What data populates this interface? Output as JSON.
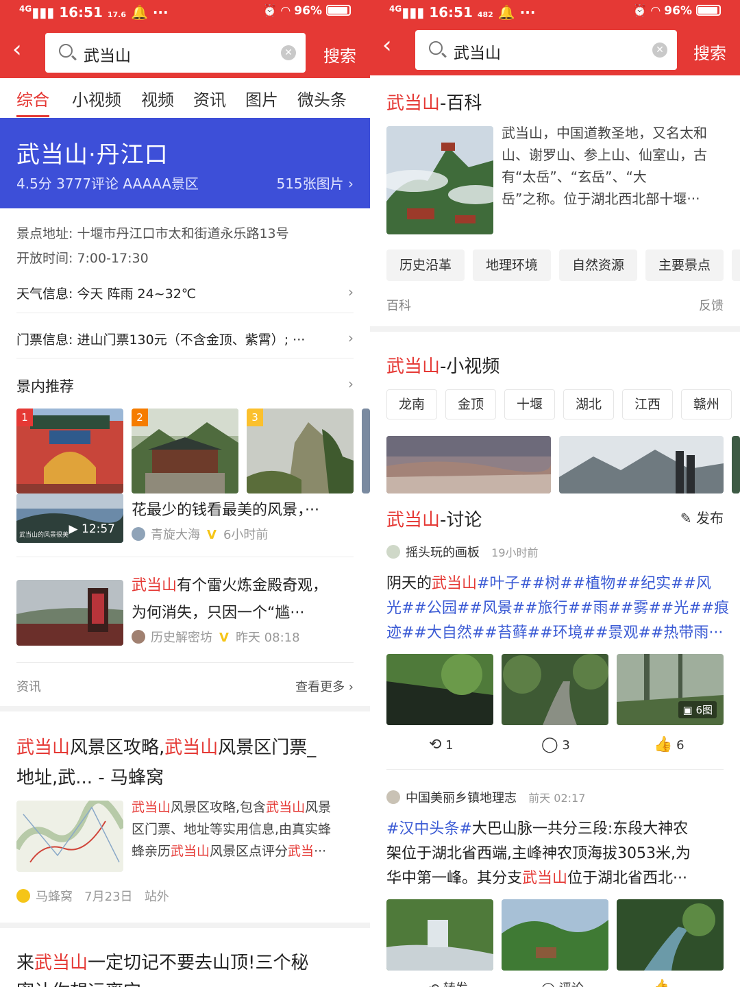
{
  "left": {
    "status": {
      "time": "16:51",
      "net": "17.6",
      "battery": "96%"
    },
    "search": {
      "query": "武当山",
      "button": "搜索"
    },
    "tabs": [
      "综合",
      "小视频",
      "视频",
      "资讯",
      "图片",
      "微头条"
    ],
    "hero": {
      "title": "武当山·丹江口",
      "meta": "4.5分  3777评论  AAAAA景区",
      "images": "515张图片 ›"
    },
    "info": {
      "address": "景点地址: 十堰市丹江口市太和街道永乐路13号",
      "hours": "开放时间: 7:00-17:30",
      "weather": "天气信息: 今天  阵雨  24~32℃",
      "ticket": "门票信息: 进山门票130元（不含金顶、紫霄）; ···"
    },
    "recommend": {
      "title": "景内推荐",
      "ranks": [
        "1",
        "2",
        "3"
      ]
    },
    "news": [
      {
        "title": "花最少的钱看最美的风景，···",
        "author": "青旋大海",
        "time": "6小时前",
        "duration": "12:57",
        "caption": "武当山的风景很美"
      },
      {
        "title_hl": "武当山",
        "title_rest": "有个雷火炼金殿奇观，",
        "title2": "为何消失，只因一个“尴···",
        "author": "历史解密坊",
        "time": "昨天 08:18"
      }
    ],
    "news_footer": {
      "label": "资讯",
      "more": "查看更多 ›"
    },
    "web1": {
      "title_a": "武当山",
      "title_b": "风景区攻略,",
      "title_c": "武当山",
      "title_d": "风景区门票_",
      "title2": "地址,武... - 马蜂窝",
      "desc1_hl": "武当山",
      "desc1_a": "风景区攻略,包含",
      "desc1_hl2": "武当山",
      "desc1_b": "风景",
      "desc2": "区门票、地址等实用信息,由真实蜂",
      "desc3_a": "蜂亲历",
      "desc3_hl": "武当山",
      "desc3_b": "风景区点评分",
      "desc3_hl2": "武当",
      "desc3_c": "···",
      "source": "马蜂窝",
      "date": "7月23日",
      "site": "站外"
    },
    "web2": {
      "title_a": "来",
      "title_hl": "武当山",
      "title_b": "一定切记不要去山顶!三个秘",
      "title2": "密让你想运离它"
    }
  },
  "right": {
    "status": {
      "time": "16:51",
      "net": "482",
      "battery": "96%"
    },
    "search": {
      "query": "武当山",
      "button": "搜索"
    },
    "baike": {
      "title_hl": "武当山",
      "title_rest": "-百科",
      "lines": [
        "武当山，中国道教圣地，又名太和",
        "山、谢罗山、参上山、仙室山，古",
        "有“太岳”、“玄岳”、“大",
        "岳”之称。位于湖北西北部十堰···"
      ],
      "chips": [
        "历史沿革",
        "地理环境",
        "自然资源",
        "主要景点"
      ],
      "footer_left": "百科",
      "footer_right": "反馈"
    },
    "videos": {
      "title_hl": "武当山",
      "title_rest": "-小视频",
      "chips": [
        "龙南",
        "金顶",
        "十堰",
        "湖北",
        "江西",
        "赣州"
      ]
    },
    "discuss": {
      "title_hl": "武当山",
      "title_rest": "-讨论",
      "post": "发布",
      "post1": {
        "author": "摇头玩的画板",
        "time": "19小时前",
        "line1_a": "阴天的",
        "line1_hl": "武当山",
        "line1_tags": "#叶子##树##植物##纪实##风",
        "line2": "光##公园##风景##旅行##雨##雾##光##痕",
        "line3": "迹##大自然##苔藓##环境##景观##热带雨···",
        "img_count": "6图",
        "reposts": "1",
        "comments": "3",
        "likes": "6"
      },
      "post2": {
        "author": "中国美丽乡镇地理志",
        "time": "前天 02:17",
        "line1_tag": "#汉中头条#",
        "line1_rest": "大巴山脉一共分三段:东段大神农",
        "line2": "架位于湖北省西端,主峰神农顶海拔3053米,为",
        "line3_a": "华中第一峰。其分支",
        "line3_hl": "武当山",
        "line3_b": "位于湖北省西北···",
        "reposts": "转发",
        "comments": "评论"
      }
    }
  },
  "colors": {
    "brand_red": "#e53935",
    "hero_blue": "#3d4fd8",
    "tag_blue": "#3a5ad4"
  }
}
